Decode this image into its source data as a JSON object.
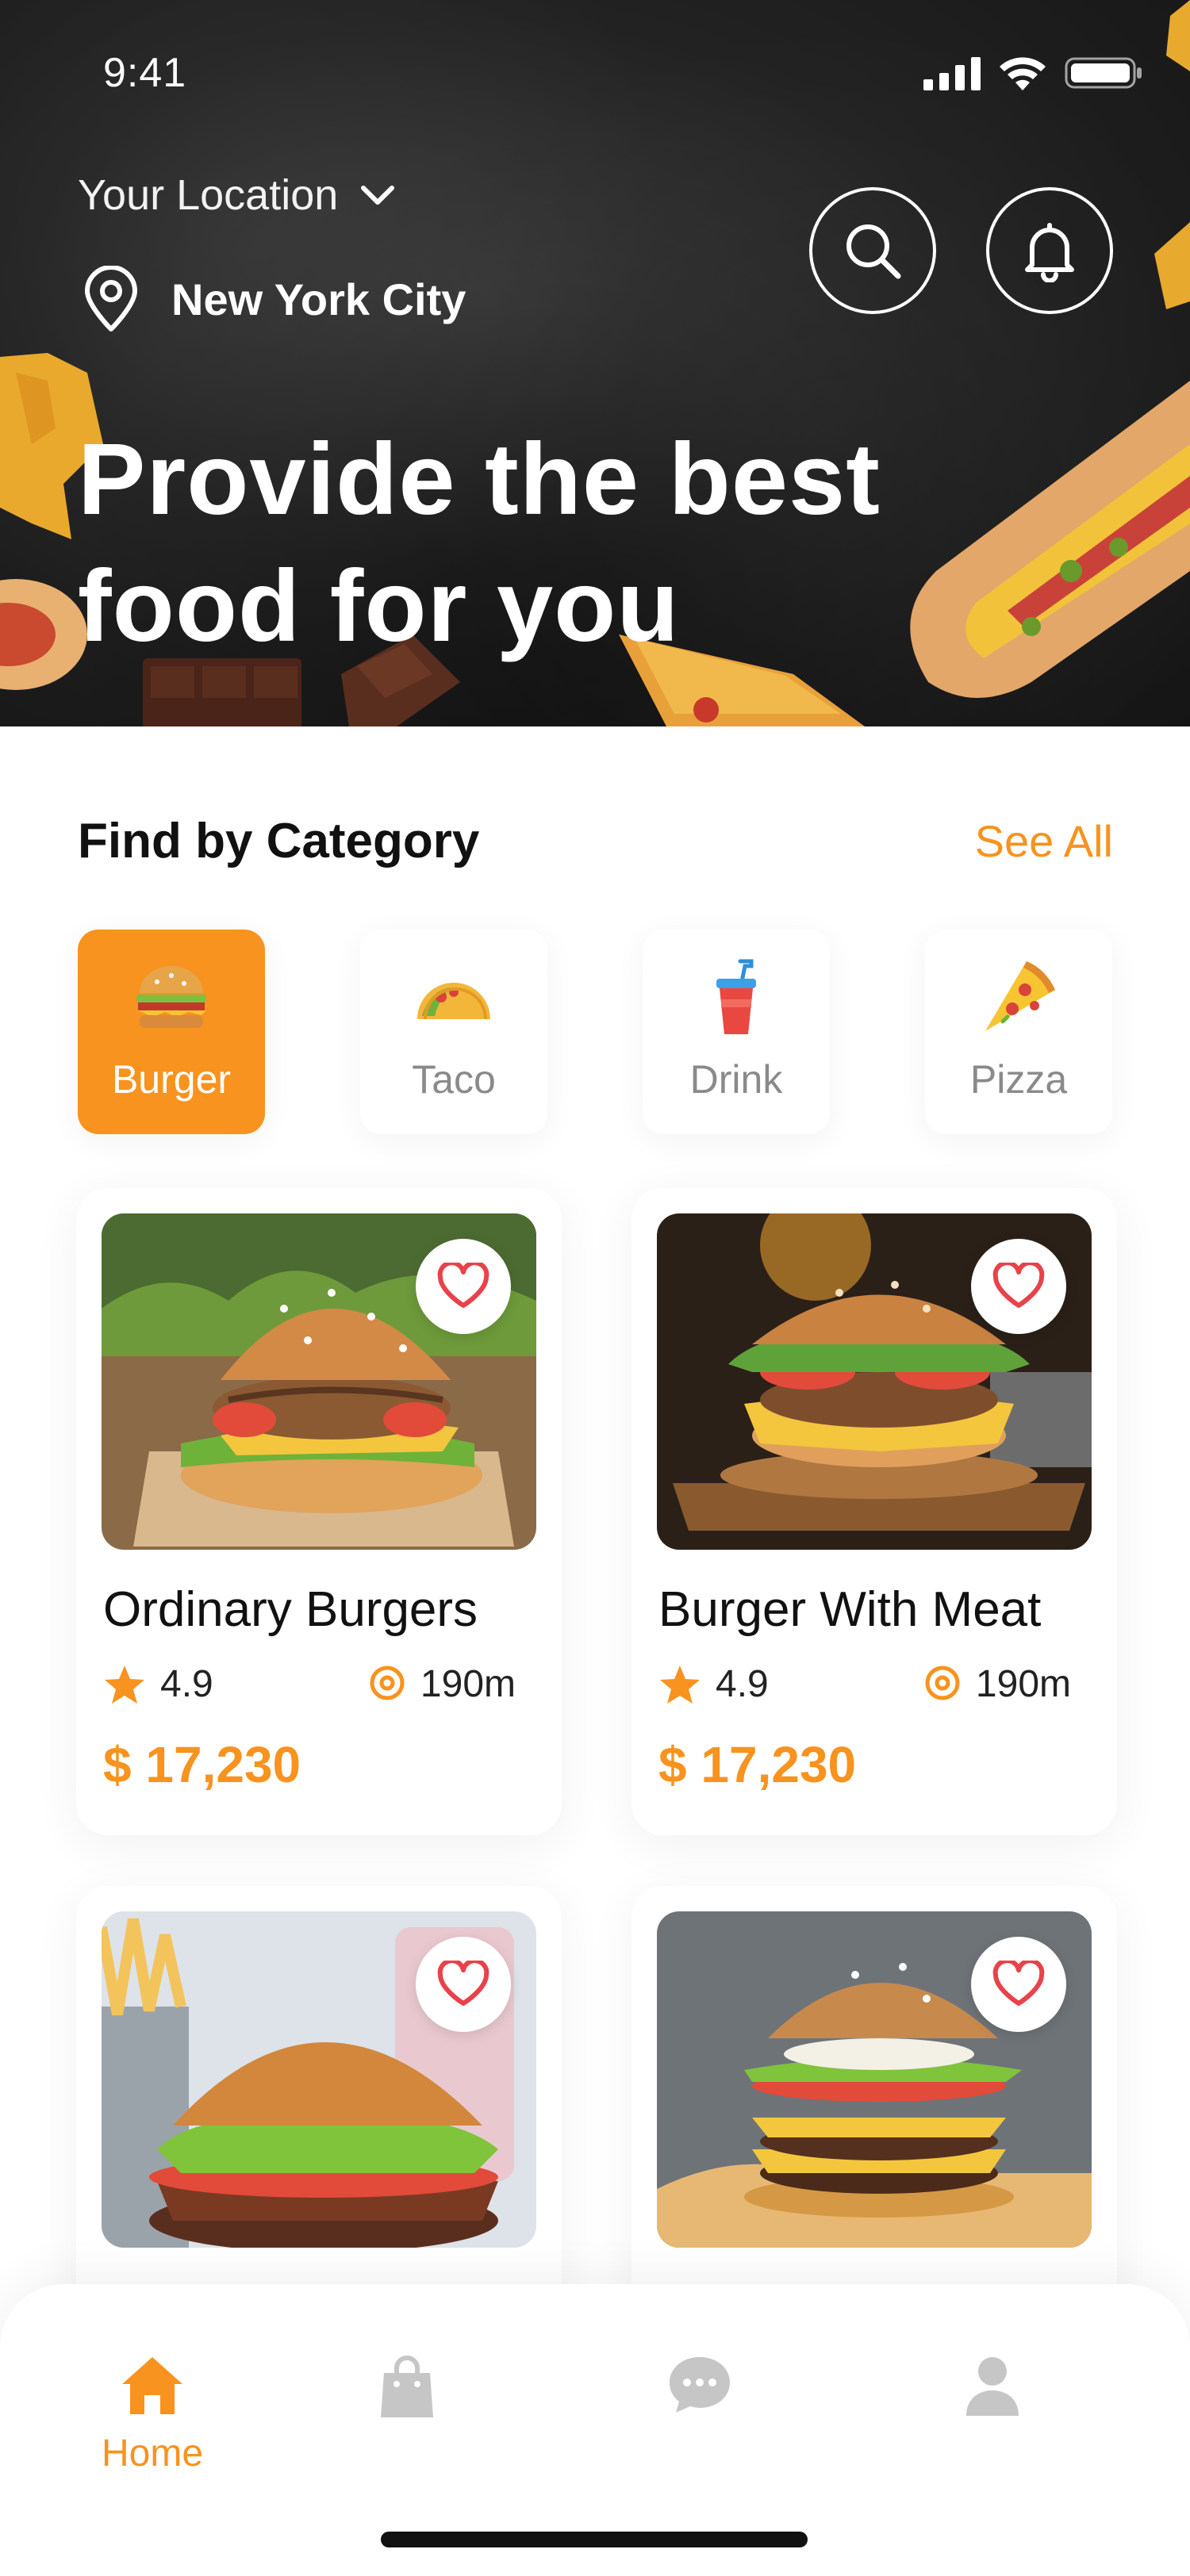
{
  "status_bar": {
    "time": "9:41"
  },
  "header": {
    "location_label": "Your Location",
    "city": "New York City",
    "headline_line1": "Provide the best",
    "headline_line2": "food for you"
  },
  "category_section": {
    "title": "Find by Category",
    "see_all": "See All",
    "items": [
      {
        "label": "Burger",
        "icon": "burger-icon",
        "active": true
      },
      {
        "label": "Taco",
        "icon": "taco-icon",
        "active": false
      },
      {
        "label": "Drink",
        "icon": "drink-icon",
        "active": false
      },
      {
        "label": "Pizza",
        "icon": "pizza-icon",
        "active": false
      }
    ]
  },
  "products": [
    {
      "name": "Ordinary Burgers",
      "rating": "4.9",
      "distance": "190m",
      "price": "$ 17,230"
    },
    {
      "name": "Burger With Meat",
      "rating": "4.9",
      "distance": "190m",
      "price": "$ 17,230"
    },
    {
      "name": "",
      "rating": "",
      "distance": "",
      "price": ""
    },
    {
      "name": "",
      "rating": "",
      "distance": "",
      "price": ""
    }
  ],
  "bottom_nav": {
    "items": [
      {
        "label": "Home",
        "icon": "home-icon",
        "active": true
      },
      {
        "label": "",
        "icon": "bag-icon",
        "active": false
      },
      {
        "label": "",
        "icon": "chat-icon",
        "active": false
      },
      {
        "label": "",
        "icon": "profile-icon",
        "active": false
      }
    ]
  },
  "colors": {
    "accent": "#F7931E",
    "heart": "#E8424B",
    "hero_bg": "#1f1f1f"
  }
}
